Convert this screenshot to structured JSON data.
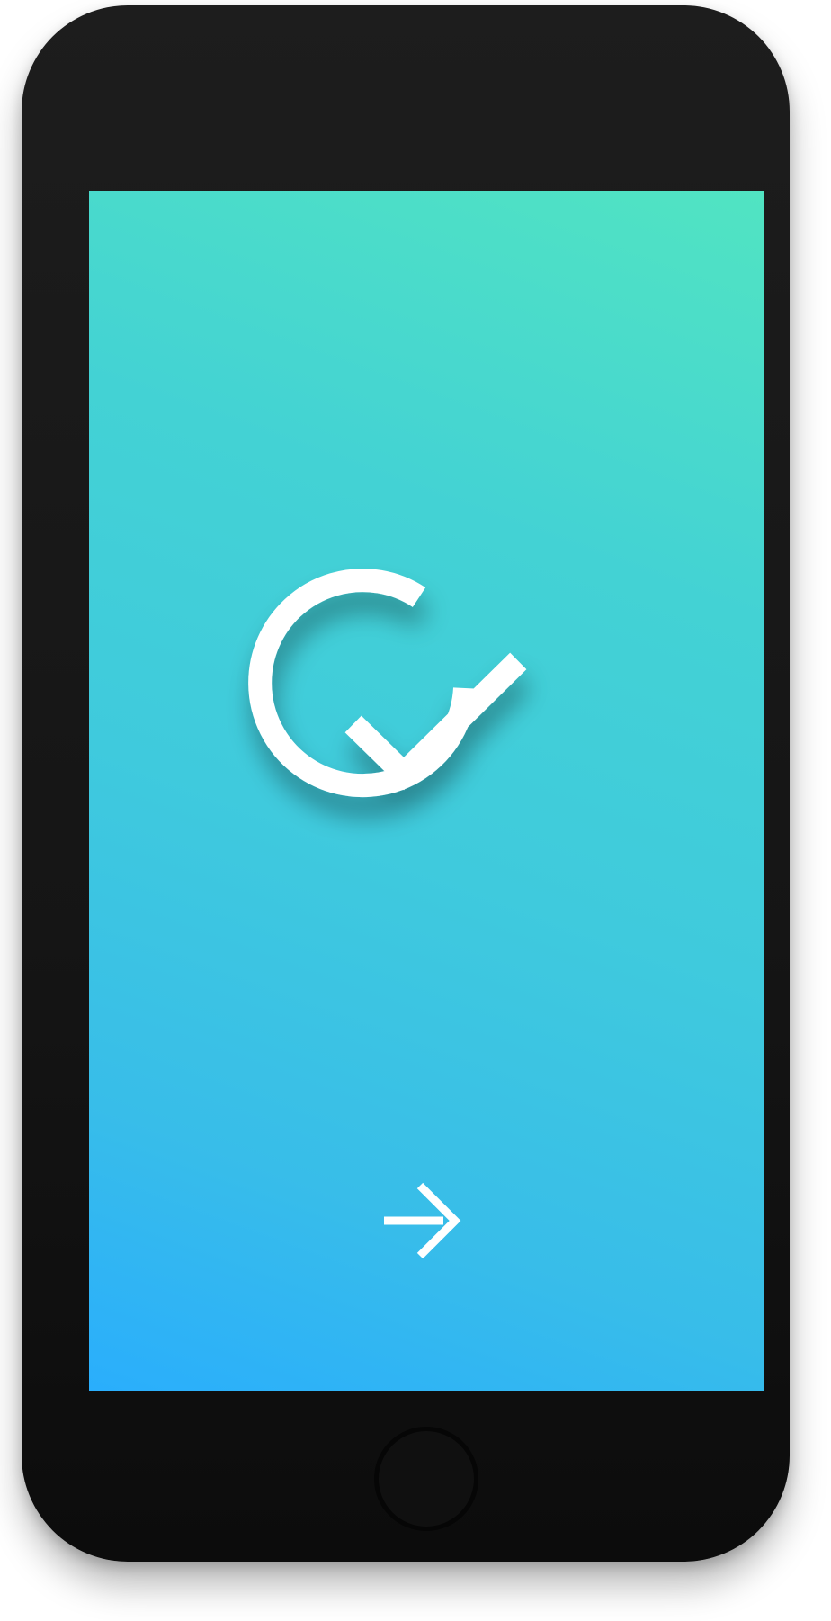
{
  "device": {
    "body_color": "#1a1a1a",
    "home_button": "home-button"
  },
  "screen": {
    "gradient_top": "#51e4c2",
    "gradient_bottom": "#2aaefc",
    "logo": {
      "icon": "check-circle-logo-icon",
      "color": "#ffffff"
    },
    "next_button": {
      "icon": "arrow-right-icon",
      "color": "#ffffff"
    }
  }
}
